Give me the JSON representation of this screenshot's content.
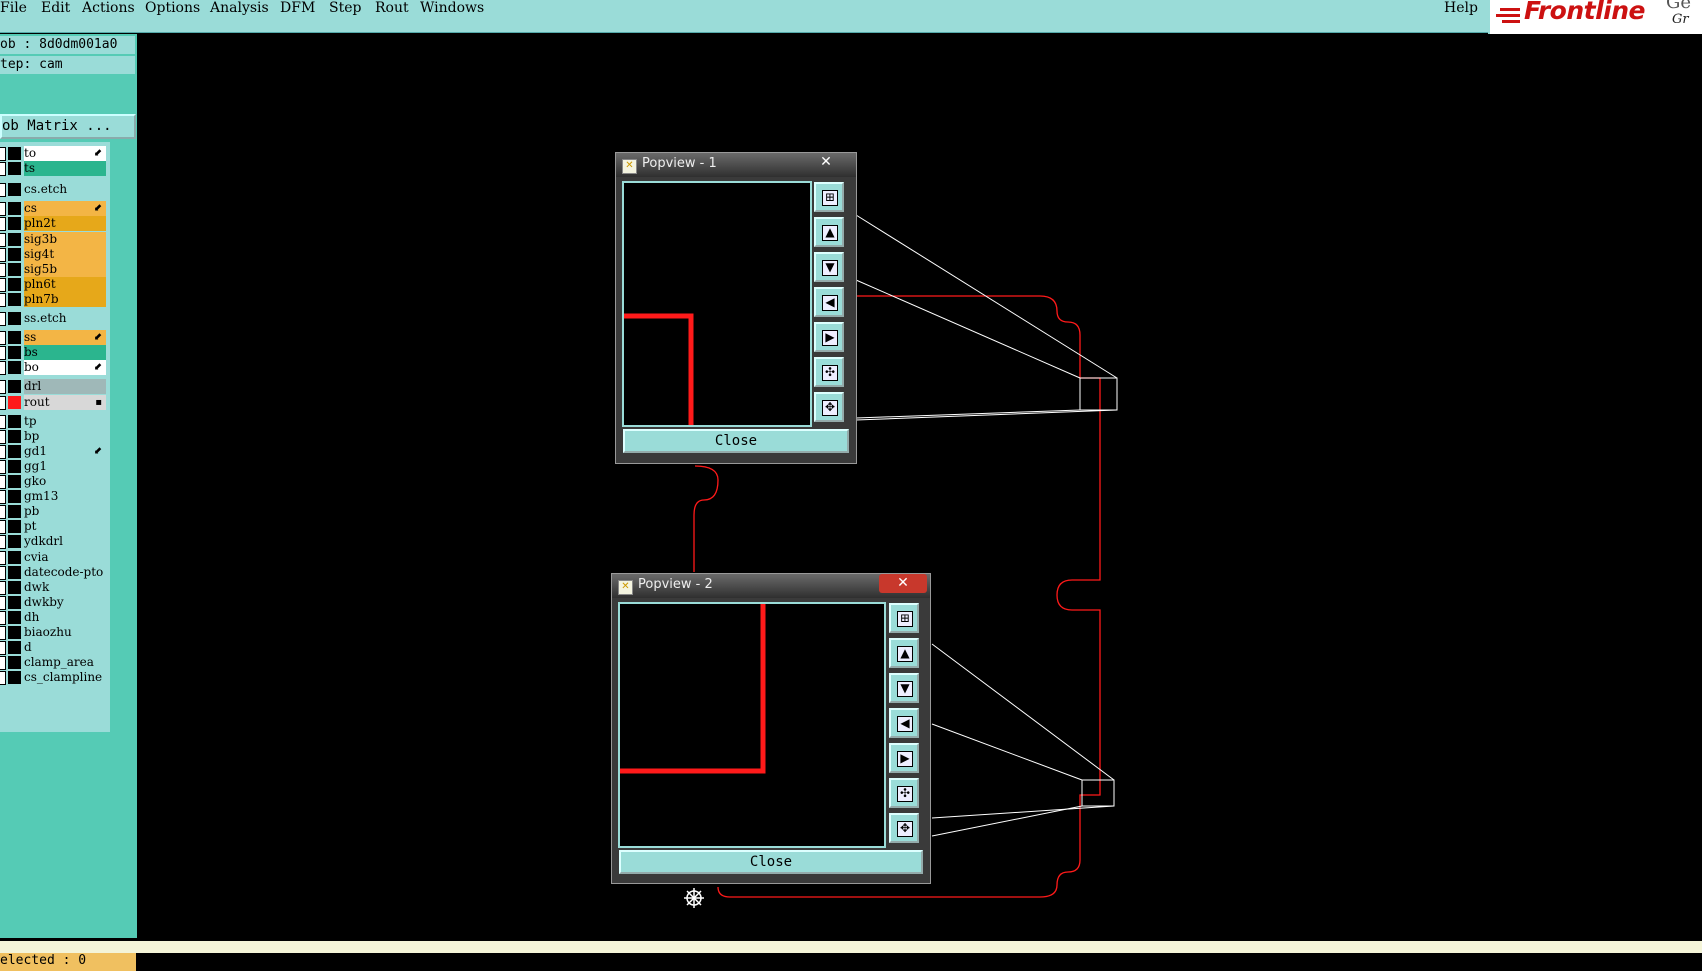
{
  "menu": [
    "File",
    "Edit",
    "Actions",
    "Options",
    "Analysis",
    "DFM",
    "Step",
    "Rout",
    "Windows"
  ],
  "help": "Help",
  "brand": {
    "logo": "Frontline",
    "sub": "Ge",
    "sub2": "Gr"
  },
  "job_label": "ob : 8d0dm001a0",
  "step_label": "tep: cam",
  "job_matrix": "ob Matrix ...",
  "layers": [
    {
      "name": "to",
      "color": "#ffffff",
      "mark": "⬋"
    },
    {
      "name": "ts",
      "color": "#2bb58e",
      "mark": ""
    },
    {
      "name": "cs.etch",
      "color": "#9adcd8",
      "mark": ""
    },
    {
      "name": "cs",
      "color": "#f3b545",
      "mark": "⬋"
    },
    {
      "name": "pln2t",
      "color": "#e6a81a",
      "mark": ""
    },
    {
      "name": "sig3b",
      "color": "#f3b545",
      "mark": ""
    },
    {
      "name": "sig4t",
      "color": "#f3b545",
      "mark": ""
    },
    {
      "name": "sig5b",
      "color": "#f3b545",
      "mark": ""
    },
    {
      "name": "pln6t",
      "color": "#e6a81a",
      "mark": ""
    },
    {
      "name": "pln7b",
      "color": "#e6a81a",
      "mark": ""
    },
    {
      "name": "ss.etch",
      "color": "#9adcd8",
      "mark": ""
    },
    {
      "name": "ss",
      "color": "#f3b545",
      "mark": "⬋"
    },
    {
      "name": "bs",
      "color": "#2bb58e",
      "mark": ""
    },
    {
      "name": "bo",
      "color": "#ffffff",
      "mark": "⬋"
    },
    {
      "name": "drl",
      "color": "#9fb8b8",
      "mark": ""
    },
    {
      "name": "rout",
      "color": "#d8d8d8",
      "mark": "▪"
    },
    {
      "name": "tp",
      "color": "#9adcd8",
      "mark": ""
    },
    {
      "name": "bp",
      "color": "#9adcd8",
      "mark": ""
    },
    {
      "name": "gd1",
      "color": "#9adcd8",
      "mark": "⬋"
    },
    {
      "name": "gg1",
      "color": "#9adcd8",
      "mark": ""
    },
    {
      "name": "gko",
      "color": "#9adcd8",
      "mark": ""
    },
    {
      "name": "gm13",
      "color": "#9adcd8",
      "mark": ""
    },
    {
      "name": "pb",
      "color": "#9adcd8",
      "mark": ""
    },
    {
      "name": "pt",
      "color": "#9adcd8",
      "mark": ""
    },
    {
      "name": "ydkdrl",
      "color": "#9adcd8",
      "mark": ""
    },
    {
      "name": "cvia",
      "color": "#9adcd8",
      "mark": ""
    },
    {
      "name": "datecode-pto",
      "color": "#9adcd8",
      "mark": ""
    },
    {
      "name": "dwk",
      "color": "#9adcd8",
      "mark": ""
    },
    {
      "name": "dwkby",
      "color": "#9adcd8",
      "mark": ""
    },
    {
      "name": "dh",
      "color": "#9adcd8",
      "mark": ""
    },
    {
      "name": "biaozhu",
      "color": "#9adcd8",
      "mark": ""
    },
    {
      "name": "d",
      "color": "#9adcd8",
      "mark": ""
    },
    {
      "name": "clamp_area",
      "color": "#9adcd8",
      "mark": ""
    },
    {
      "name": "cs_clampline",
      "color": "#9adcd8",
      "mark": ""
    }
  ],
  "selected": "elected : 0",
  "popviews": [
    {
      "title": "Popview - 1",
      "close_x": "✕",
      "close": "Close"
    },
    {
      "title": "Popview - 2",
      "close_x": "✕",
      "close": "Close"
    }
  ],
  "colors": {
    "menu_bg": "#9adcd8",
    "panel_bg": "#55cbb5",
    "rout": "#ff1a1a",
    "close_red": "#c8382c"
  }
}
